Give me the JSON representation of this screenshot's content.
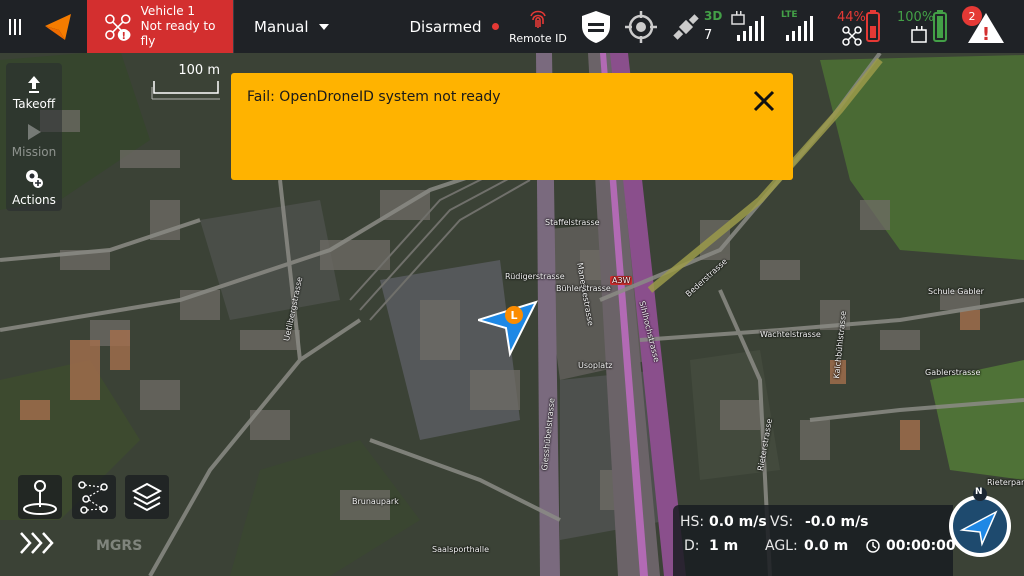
{
  "topbar": {
    "vehicle": {
      "name": "Vehicle 1",
      "status": "Not ready to fly"
    },
    "flight_mode": "Manual",
    "arm_state": "Disarmed",
    "remote_id_label": "Remote ID",
    "gps": {
      "fix": "3D",
      "satellites": "7"
    },
    "link_label": "LTE",
    "vehicle_battery": "44%",
    "controller_battery": "100%",
    "alert_count": "2",
    "colors": {
      "vehicle_bg": "#d32f2f",
      "fix": "#43a047",
      "battery_low": "#e53935",
      "battery_full": "#43a047"
    }
  },
  "left_toolbar": {
    "items": [
      {
        "label": "Takeoff",
        "icon": "takeoff-arrow-icon"
      },
      {
        "label": "Mission",
        "icon": "play-icon"
      },
      {
        "label": "Actions",
        "icon": "waypoint-pin-icon"
      }
    ]
  },
  "map": {
    "scale_label": "100 m",
    "coord_system": "MGRS",
    "street_labels": [
      "Manessestrasse",
      "Bederstrasse",
      "Sihlhochstrasse",
      "Giesshübelstrasse",
      "Schule Gabler",
      "Brunaupark",
      "Saalsporthalle",
      "Rieterpark",
      "Kalchbühlstrasse",
      "Uetlibergstrasse",
      "Rüdigerstrasse",
      "Bühlerstrasse",
      "Usoplatz",
      "Gablerstrasse",
      "Rieterstrasse",
      "Wachtelstrasse",
      "Staffelstrasse",
      "A3W"
    ],
    "vehicle_marker_letter": "L"
  },
  "notification": {
    "message": "Fail: OpenDroneID system not ready",
    "color": "#ffb300"
  },
  "telemetry": {
    "hs_label": "HS:",
    "hs_value": "0.0 m/s",
    "vs_label": "VS:",
    "vs_value": "-0.0 m/s",
    "d_label": "D:",
    "d_value": "1 m",
    "agl_label": "AGL:",
    "agl_value": "0.0 m",
    "time_value": "00:00:00"
  },
  "compass": {
    "north_label": "N"
  }
}
